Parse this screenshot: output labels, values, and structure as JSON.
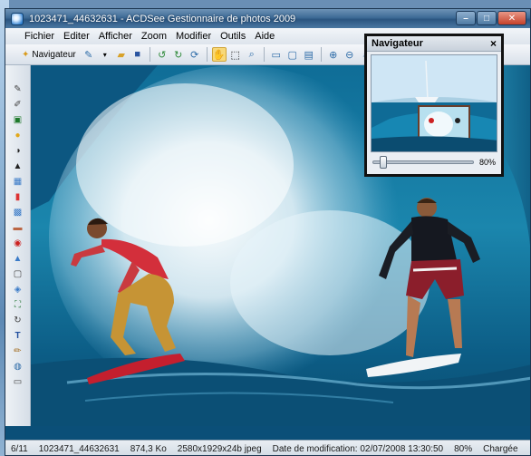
{
  "window": {
    "title": "1023471_44632631 - ACDSee Gestionnaire de photos 2009"
  },
  "menu": [
    {
      "label": "Fichier"
    },
    {
      "label": "Editer"
    },
    {
      "label": "Afficher"
    },
    {
      "label": "Zoom"
    },
    {
      "label": "Modifier"
    },
    {
      "label": "Outils"
    },
    {
      "label": "Aide"
    }
  ],
  "toolbar": {
    "navigator_label": "Navigateur"
  },
  "navigator": {
    "title": "Navigateur",
    "close": "×",
    "zoom_label": "80%",
    "zoom_fraction": 0.1
  },
  "status": {
    "position": "6/11",
    "filename": "1023471_44632631",
    "filesize": "874,3 Ko",
    "dimensions": "2580x1929x24b jpeg",
    "modified": "Date de modification: 02/07/2008 13:30:50",
    "zoom": "80%",
    "state": "Chargée"
  },
  "colors": {
    "titlebar": "#2b5580",
    "wave_dark": "#0d5a86",
    "wave_light": "#3d9fc4",
    "spray": "#e9f3f8",
    "highlight": "#f7d879"
  }
}
